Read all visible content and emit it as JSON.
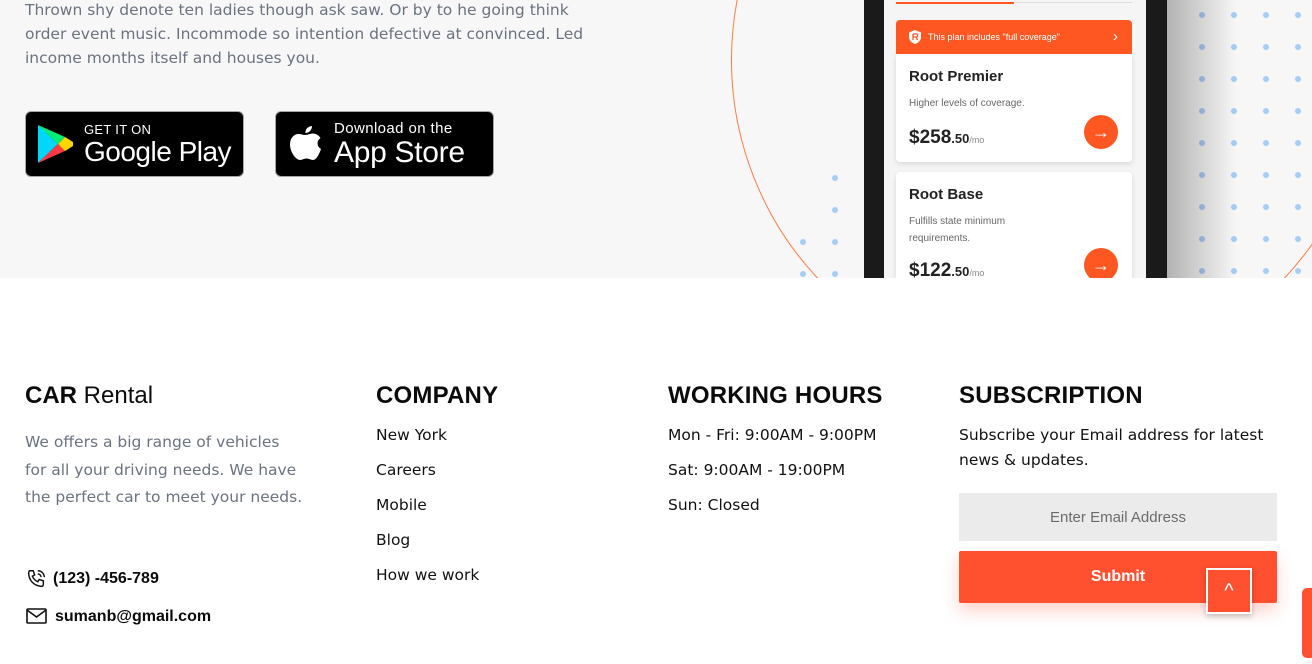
{
  "hero": {
    "description": "Thrown shy denote ten ladies though ask saw. Or by to he going think order event music. Incommode so intention defective at convinced. Led income months itself and houses you.",
    "google_play": {
      "small": "GET IT ON",
      "big": "Google Play"
    },
    "app_store": {
      "small": "Download on the",
      "big": "App Store"
    }
  },
  "phone": {
    "banner": "This plan includes \"full coverage\"",
    "plans": [
      {
        "name": "Root Premier",
        "desc": "Higher levels of coverage.",
        "price": "$258",
        "cents": ".50",
        "per": "/mo"
      },
      {
        "name": "Root Base",
        "desc": "Fulfills state minimum requirements.",
        "price": "$122",
        "cents": ".50",
        "per": "/mo"
      }
    ]
  },
  "footer": {
    "brand_bold": "CAR",
    "brand_rest": " Rental",
    "about": "We offers a big range of vehicles for all your driving needs. We have the perfect car to meet your needs.",
    "phone": "(123) -456-789",
    "email": "sumanb@gmail.com",
    "company": {
      "heading": "COMPANY",
      "links": [
        "New York",
        "Careers",
        "Mobile",
        "Blog",
        "How we work"
      ]
    },
    "hours": {
      "heading": "WORKING HOURS",
      "lines": [
        "Mon - Fri: 9:00AM - 9:00PM",
        "Sat: 9:00AM - 19:00PM",
        "Sun: Closed"
      ]
    },
    "subscription": {
      "heading": "SUBSCRIPTION",
      "text": "Subscribe your Email address for latest news & updates.",
      "placeholder": "Enter Email Address",
      "submit": "Submit"
    },
    "back_to_top": "^"
  },
  "colors": {
    "accent": "#ff5030",
    "band_bg": "#f7f7f7",
    "dot": "#a9cdf0"
  }
}
